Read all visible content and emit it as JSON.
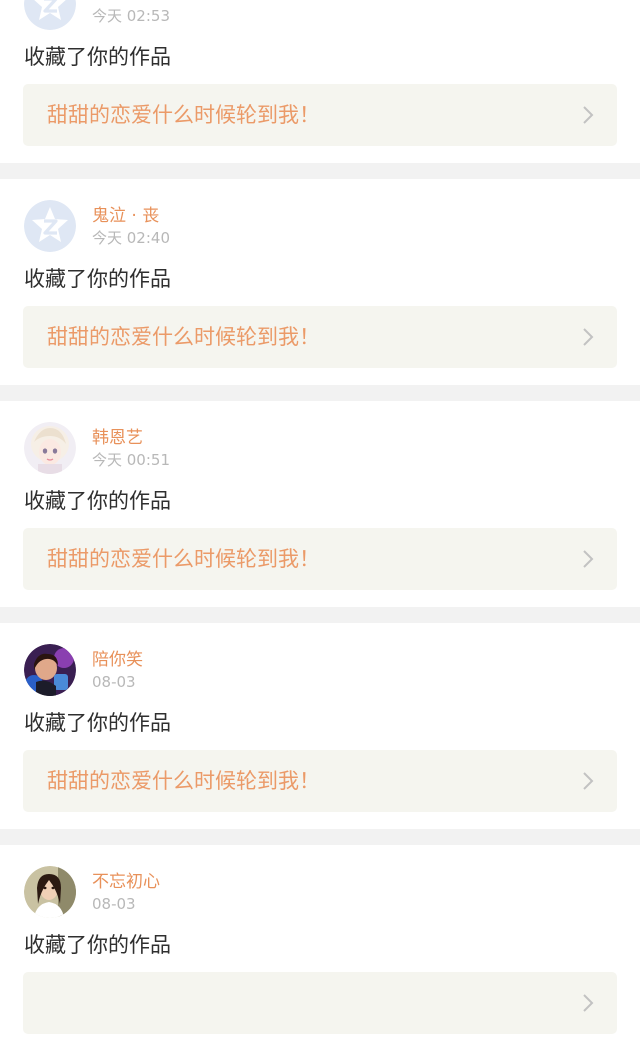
{
  "notifications": [
    {
      "username": "",
      "time": "今天 02:53",
      "avatar": "default-avatar-icon",
      "action": "收藏了你的作品",
      "work_title": "甜甜的恋爱什么时候轮到我！"
    },
    {
      "username": "鬼泣 · 丧",
      "time": "今天 02:40",
      "avatar": "default-avatar-icon",
      "action": "收藏了你的作品",
      "work_title": "甜甜的恋爱什么时候轮到我！"
    },
    {
      "username": "韩恩艺",
      "time": "今天 00:51",
      "avatar": "user-avatar-anime-girl",
      "action": "收藏了你的作品",
      "work_title": "甜甜的恋爱什么时候轮到我！"
    },
    {
      "username": "陪你笑",
      "time": "08-03",
      "avatar": "user-avatar-photo",
      "action": "收藏了你的作品",
      "work_title": "甜甜的恋爱什么时候轮到我！"
    },
    {
      "username": "不忘初心",
      "time": "08-03",
      "avatar": "user-avatar-photo",
      "action": "收藏了你的作品",
      "work_title": ""
    }
  ],
  "colors": {
    "username": "#e8915a",
    "work_title": "#eb9a68",
    "action_text": "#2f2f2f",
    "time_text": "#b8b8b8",
    "link_background": "#f5f5ef",
    "separator": "#f2f2f2",
    "default_avatar": "#dfe7f4"
  },
  "icons": {
    "chevron": "chevron-right-icon"
  }
}
